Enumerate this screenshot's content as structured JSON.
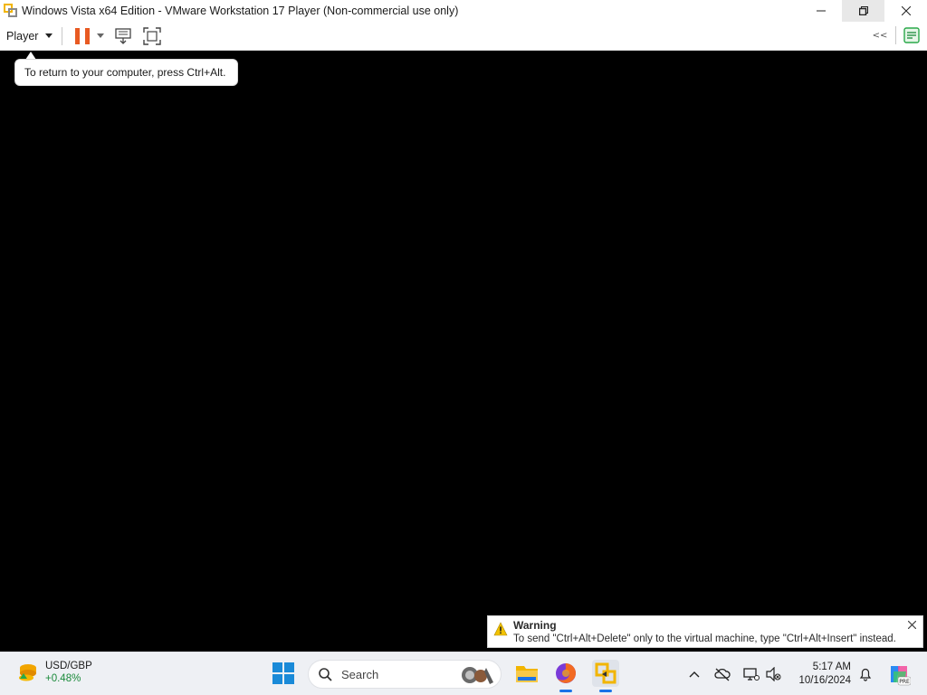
{
  "window": {
    "title": "Windows Vista x64 Edition - VMware Workstation 17 Player (Non-commercial use only)",
    "icon": "vmware-player-icon"
  },
  "toolbar": {
    "player_label": "Player",
    "collapse_label": "<<"
  },
  "tooltip": {
    "text": "To return to your computer, press Ctrl+Alt."
  },
  "warning": {
    "title": "Warning",
    "message": "To send \"Ctrl+Alt+Delete\" only to the virtual machine, type \"Ctrl+Alt+Insert\" instead."
  },
  "taskbar": {
    "widget": {
      "title": "USD/GBP",
      "value": "+0.48%"
    },
    "search_placeholder": "Search",
    "clock_time": "5:17 AM",
    "clock_date": "10/16/2024",
    "copilot_badge": "PRE"
  },
  "colors": {
    "pause_orange": "#e85a22",
    "accent_blue": "#1a73e8",
    "widget_green": "#1a8a3a"
  }
}
